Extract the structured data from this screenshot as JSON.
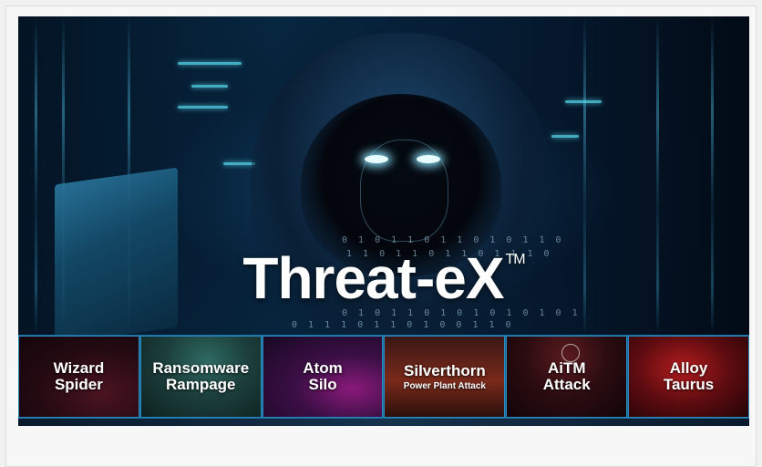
{
  "banner": {
    "title": "Threat-eX",
    "trademark": "TM",
    "binary_lines": [
      "0 1 0 1 1 0 1   1 0 1 0 1 1 0",
      "1 1 0 1   1 0 1   1 0 1 1 1 0",
      "0 1 0 1 1 0 1 0 1 0 1 0 1 0 1",
      "0 1 1 1 0 1   1 0 1 0 0 1 1 0"
    ]
  },
  "tiles": [
    {
      "name": "Wizard\nSpider",
      "sub": ""
    },
    {
      "name": "Ransomware\nRampage",
      "sub": ""
    },
    {
      "name": "Atom\nSilo",
      "sub": ""
    },
    {
      "name": "Silverthorn",
      "sub": "Power Plant Attack"
    },
    {
      "name": "AiTM\nAttack",
      "sub": ""
    },
    {
      "name": "Alloy\nTaurus",
      "sub": ""
    }
  ]
}
